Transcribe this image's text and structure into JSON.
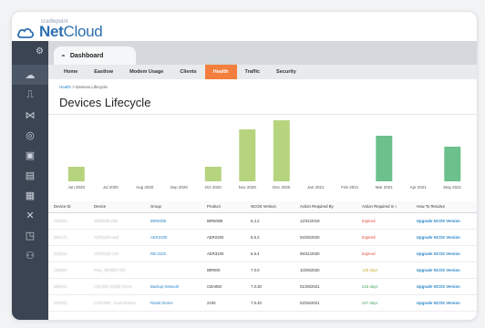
{
  "brand": {
    "product_small": "cradlepoint",
    "product_name_bold": "Net",
    "product_name": "Cloud"
  },
  "header": {
    "dashboard_tab": "Dashboard"
  },
  "nav": [
    {
      "label": "Home"
    },
    {
      "label": "Eastlow"
    },
    {
      "label": "Modem Usage"
    },
    {
      "label": "Clients"
    },
    {
      "label": "Health",
      "active": true
    },
    {
      "label": "Traffic"
    },
    {
      "label": "Security"
    }
  ],
  "breadcrumb": {
    "link": "Health",
    "sep": " > ",
    "current": "Devices Lifecycle"
  },
  "page_title": "Devices Lifecycle",
  "chart_data": {
    "type": "bar",
    "categories": [
      "Jun 2020",
      "Jul 2020",
      "Aug 2020",
      "Sep 2020",
      "Oct 2020",
      "Nov 2020",
      "Dec 2020",
      "Jan 2021",
      "Feb 2021",
      "Mar 2021",
      "Apr 2021",
      "May 2021"
    ],
    "values": [
      16,
      0,
      0,
      0,
      16,
      57,
      67,
      0,
      0,
      50,
      0,
      38
    ],
    "colors": [
      "#b6d47e",
      "#b6d47e",
      "#b6d47e",
      "#b6d47e",
      "#b6d47e",
      "#b6d47e",
      "#b6d47e",
      "#b6d47e",
      "#b6d47e",
      "#6cc08b",
      "#6cc08b",
      "#6cc08b"
    ],
    "ylim": [
      0,
      70
    ],
    "grid": false
  },
  "table": {
    "headers": [
      "Device ID",
      "Device",
      "Group",
      "Product",
      "NCOS Version",
      "Action Required By",
      "Action Required In ↕",
      "How To Resolve"
    ],
    "rows": [
      {
        "id": "765656",
        "device": "IBR600B-15B",
        "group": "IBR600B",
        "group_link": true,
        "product": "IBR600B",
        "ncos": "6.4.2",
        "by": "12/31/2019",
        "in": "Expired",
        "in_class": "red",
        "resolve": "Upgrade NCOS Version"
      },
      {
        "id": "980175",
        "device": "AER2200-wall",
        "group": "AER2200",
        "group_link": true,
        "product": "AER2200",
        "ncos": "6.5.2",
        "by": "04/25/2020",
        "in": "Expired",
        "in_class": "red",
        "resolve": "Upgrade NCOS Version"
      },
      {
        "id": "923826",
        "device": "AER3100-103",
        "group": "RB-3100",
        "group_link": true,
        "product": "AER3100",
        "ncos": "6.5.4",
        "by": "05/31/2020",
        "in": "Expired",
        "in_class": "red",
        "resolve": "Upgrade NCOS Version"
      },
      {
        "id": "190894",
        "device": "Prav_IBR900-759",
        "group": "",
        "group_link": false,
        "product": "IBR900",
        "ncos": "7.0.0",
        "by": "10/29/2020",
        "in": "128 days",
        "in_class": "amber",
        "resolve": "Upgrade NCOS Version"
      },
      {
        "id": "985043",
        "device": "CBA850-10388 Demo",
        "group": "Backup Network",
        "group_link": true,
        "product": "CBA850",
        "ncos": "7.0.30",
        "by": "01/28/2021",
        "in": "218 days",
        "in_class": "green",
        "resolve": "Upgrade NCOS Version"
      },
      {
        "id": "940265",
        "device": "2100-998 - Dual Modem",
        "group": "Retail Stores",
        "group_link": true,
        "product": "2100",
        "ncos": "7.0.40",
        "by": "02/25/2021",
        "in": "247 days",
        "in_class": "green",
        "resolve": "Upgrade NCOS Version"
      }
    ]
  },
  "sidebar": {
    "items": [
      {
        "icon": "cloud-icon"
      },
      {
        "icon": "routers-icon"
      },
      {
        "icon": "network-icon"
      },
      {
        "icon": "globe-icon"
      },
      {
        "icon": "reports-icon"
      },
      {
        "icon": "document-icon"
      },
      {
        "icon": "calendar-icon"
      },
      {
        "icon": "tools-icon"
      },
      {
        "icon": "apps-icon"
      },
      {
        "icon": "users-icon"
      }
    ]
  }
}
